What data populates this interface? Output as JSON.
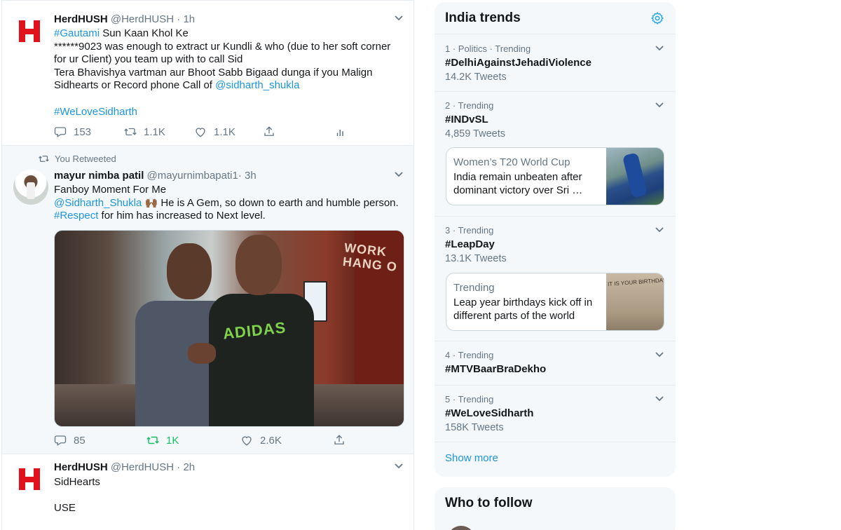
{
  "feed": {
    "tweets": [
      {
        "name": "HerdHUSH",
        "handle": "@HerdHUSH",
        "dot": "·",
        "time": "1h",
        "lines": [
          {
            "link": "#Gautami",
            "text": " Sun Kaan Khol Ke"
          },
          {
            "text": "******9023 was enough to extract ur Kundli & who (due to her soft corner"
          },
          {
            "text": "for ur Client) you team up with to call Sid"
          },
          {
            "text": "Tera Bhavishya vartman aur Bhoot Sabb Bigaad dunga if you Malign"
          },
          {
            "text": "Sidhearts or Record phone Call of ",
            "link": "@sidharth_shukla"
          },
          {
            "link": "#WeLoveSidharth"
          }
        ],
        "replies": "153",
        "retweets": "1.1K",
        "likes": "1.1K"
      },
      {
        "retweet_note": "You Retweeted",
        "name": "mayur nimba patil",
        "handle": "@mayurnimbapati1",
        "dot": "·",
        "time": "3h",
        "lines": [
          {
            "text": "Fanboy Moment For Me"
          },
          {
            "link": "@Sidharth_Shukla",
            "text": " 🙌🏾 He is A Gem, so down to earth and humble person."
          },
          {
            "link": "#Respect",
            "text": " for him has increased to Next level."
          }
        ],
        "photo_text_wall": "WORK\nHANG O",
        "photo_text_shirt": "ADIDAS",
        "replies": "85",
        "retweets": "1K",
        "likes": "2.6K"
      },
      {
        "name": "HerdHUSH",
        "handle": "@HerdHUSH",
        "dot": "·",
        "time": "2h",
        "lines": [
          {
            "text": "SidHearts"
          },
          {
            "text": "USE"
          }
        ]
      }
    ]
  },
  "trends": {
    "title": "India trends",
    "items": [
      {
        "meta": "1 · Politics · Trending",
        "tag": "#DelhiAgainstJehadiViolence",
        "count": "14.2K Tweets"
      },
      {
        "meta": "2 · Trending",
        "tag": "#INDvSL",
        "count": "4,859 Tweets",
        "card": {
          "title": "Women’s T20 World Cup",
          "body": "India remain unbeaten after dominant victory over Sri …"
        }
      },
      {
        "meta": "3 · Trending",
        "tag": "#LeapDay",
        "count": "13.1K Tweets",
        "card": {
          "title": "Trending",
          "body": "Leap year birthdays kick off in different parts of the world"
        }
      },
      {
        "meta": "4 · Trending",
        "tag": "#MTVBaarBraDekho",
        "count": ""
      },
      {
        "meta": "5 · Trending",
        "tag": "#WeLoveSidharth",
        "count": "158K Tweets"
      }
    ],
    "show_more": "Show more"
  },
  "who_to_follow": {
    "title": "Who to follow"
  },
  "colors": {
    "link": "#1b95e0",
    "accent": "#1da1f2",
    "retweet_active": "#17bf63",
    "logo_red": "#e0121c"
  },
  "icons": [
    "h-logo-icon",
    "chevron-down-icon",
    "reply-icon",
    "retweet-icon",
    "like-icon",
    "share-icon",
    "analytics-icon",
    "gear-icon"
  ]
}
